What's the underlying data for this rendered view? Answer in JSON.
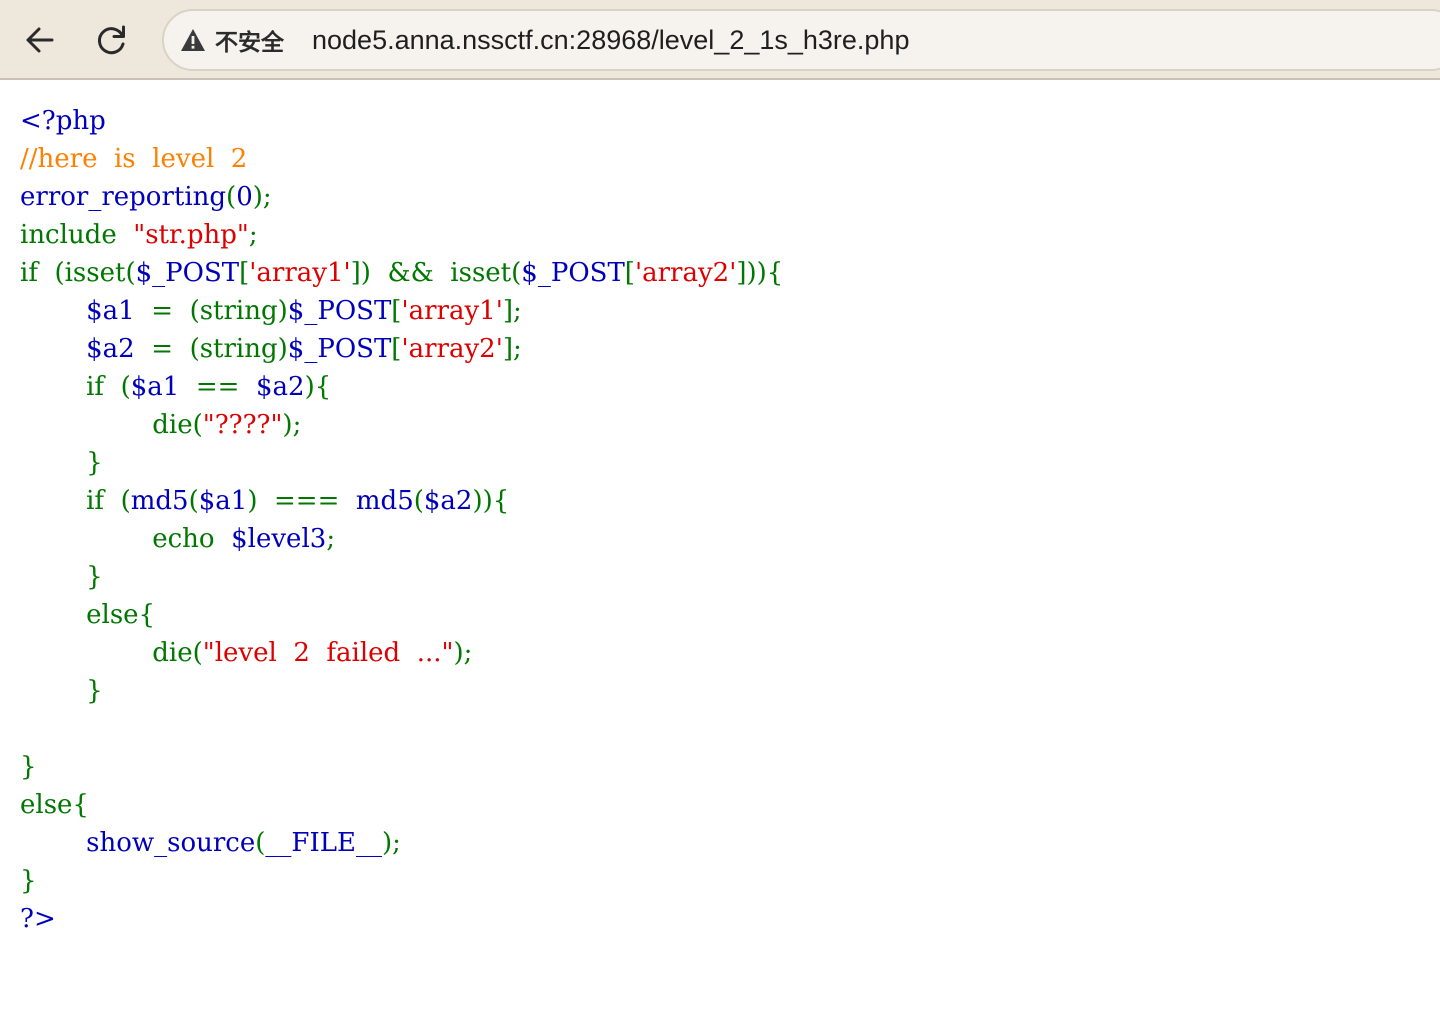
{
  "browser": {
    "security_label": "不安全",
    "url": "node5.anna.nssctf.cn:28968/level_2_1s_h3re.php",
    "back_icon": "arrow-left-icon",
    "reload_icon": "reload-icon",
    "warning_icon": "warning-triangle-icon"
  },
  "colors": {
    "default": "#0000bb",
    "keyword": "#007700",
    "string": "#dd0000",
    "comment": "#ff8000",
    "toolbar_bg": "#eee8dc"
  },
  "source_lines": [
    [
      [
        "d",
        "<?php"
      ]
    ],
    [
      [
        "c",
        "//here  is  level  2"
      ]
    ],
    [
      [
        "d",
        "error_reporting"
      ],
      [
        "k",
        "("
      ],
      [
        "d",
        "0"
      ],
      [
        "k",
        ");"
      ]
    ],
    [
      [
        "k",
        "include  "
      ],
      [
        "s",
        "\"str.php\""
      ],
      [
        "k",
        ";"
      ]
    ],
    [
      [
        "k",
        "if  (isset("
      ],
      [
        "d",
        "$_POST"
      ],
      [
        "k",
        "["
      ],
      [
        "s",
        "'array1'"
      ],
      [
        "k",
        "])  &&  isset("
      ],
      [
        "d",
        "$_POST"
      ],
      [
        "k",
        "["
      ],
      [
        "s",
        "'array2'"
      ],
      [
        "k",
        "])){"
      ]
    ],
    [
      [
        "k",
        "        "
      ],
      [
        "d",
        "$a1  "
      ],
      [
        "k",
        "=  (string)"
      ],
      [
        "d",
        "$_POST"
      ],
      [
        "k",
        "["
      ],
      [
        "s",
        "'array1'"
      ],
      [
        "k",
        "];"
      ]
    ],
    [
      [
        "k",
        "        "
      ],
      [
        "d",
        "$a2  "
      ],
      [
        "k",
        "=  (string)"
      ],
      [
        "d",
        "$_POST"
      ],
      [
        "k",
        "["
      ],
      [
        "s",
        "'array2'"
      ],
      [
        "k",
        "];"
      ]
    ],
    [
      [
        "k",
        "        if  ("
      ],
      [
        "d",
        "$a1  "
      ],
      [
        "k",
        "==  "
      ],
      [
        "d",
        "$a2"
      ],
      [
        "k",
        "){"
      ]
    ],
    [
      [
        "k",
        "                die("
      ],
      [
        "s",
        "\"????\""
      ],
      [
        "k",
        ");"
      ]
    ],
    [
      [
        "k",
        "        }"
      ]
    ],
    [
      [
        "k",
        "        if  ("
      ],
      [
        "d",
        "md5"
      ],
      [
        "k",
        "("
      ],
      [
        "d",
        "$a1"
      ],
      [
        "k",
        ")  ===  "
      ],
      [
        "d",
        "md5"
      ],
      [
        "k",
        "("
      ],
      [
        "d",
        "$a2"
      ],
      [
        "k",
        ")){"
      ]
    ],
    [
      [
        "k",
        "                echo  "
      ],
      [
        "d",
        "$level3"
      ],
      [
        "k",
        ";"
      ]
    ],
    [
      [
        "k",
        "        }"
      ]
    ],
    [
      [
        "k",
        "        else{"
      ]
    ],
    [
      [
        "k",
        "                die("
      ],
      [
        "s",
        "\"level  2  failed  ...\""
      ],
      [
        "k",
        ");"
      ]
    ],
    [
      [
        "k",
        "        }"
      ]
    ],
    [
      [
        "k",
        ""
      ]
    ],
    [
      [
        "k",
        "}"
      ]
    ],
    [
      [
        "k",
        "else{"
      ]
    ],
    [
      [
        "k",
        "        "
      ],
      [
        "d",
        "show_source"
      ],
      [
        "k",
        "("
      ],
      [
        "d",
        "__FILE__"
      ],
      [
        "k",
        ");"
      ]
    ],
    [
      [
        "k",
        "}"
      ]
    ],
    [
      [
        "d",
        "?>"
      ]
    ]
  ]
}
